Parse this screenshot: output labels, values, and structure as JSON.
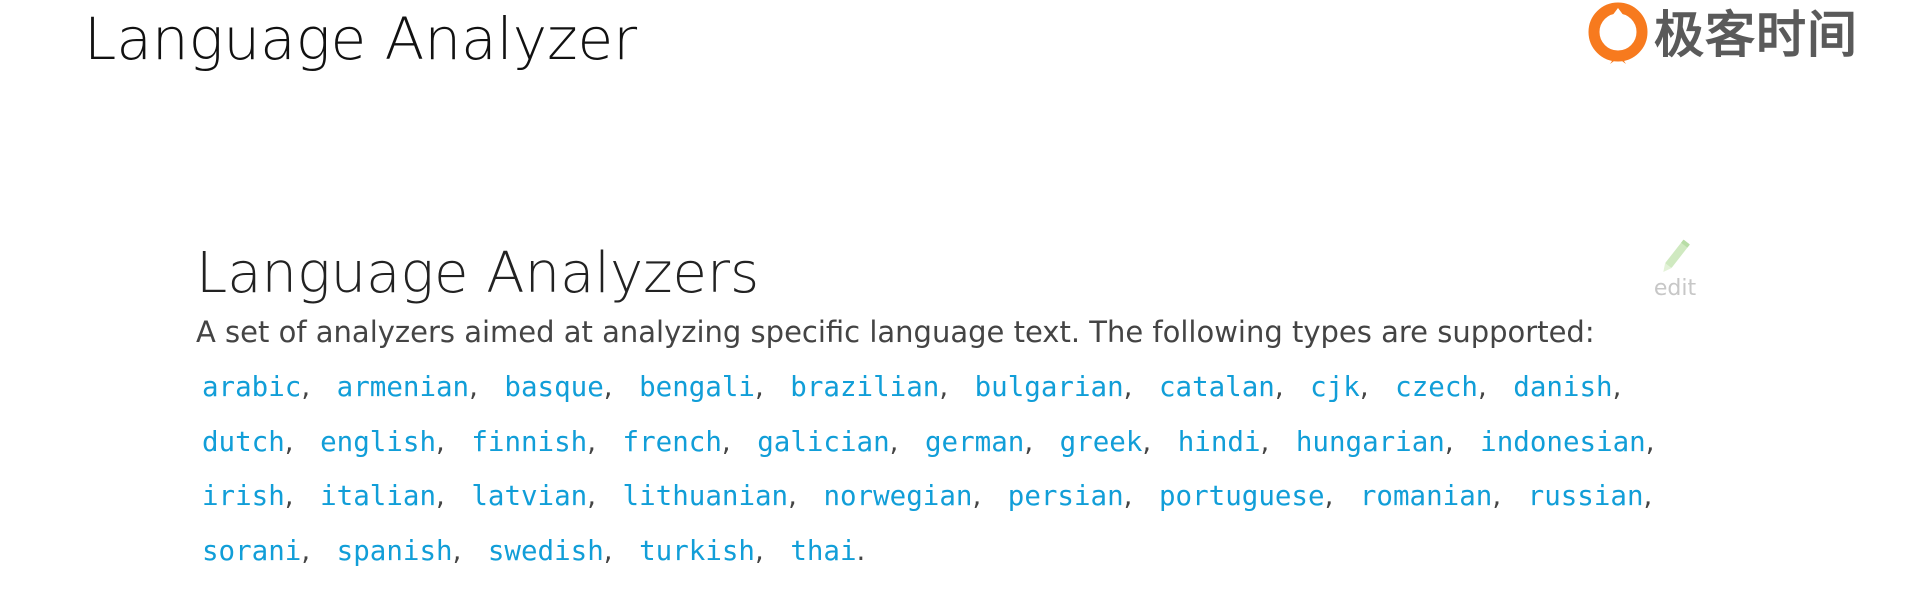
{
  "slide": {
    "title": "Language Analyzer"
  },
  "brand": {
    "name": "极客时间",
    "logo_icon": "geektime-logo-icon",
    "accent_color": "#f77a1e"
  },
  "doc": {
    "title": "Language Analyzers",
    "edit_label": "edit",
    "edit_icon": "pencil-icon",
    "description": "A set of analyzers aimed at analyzing specific language text. The following types are supported:",
    "link_color": "#119ed8",
    "languages": [
      "arabic",
      "armenian",
      "basque",
      "bengali",
      "brazilian",
      "bulgarian",
      "catalan",
      "cjk",
      "czech",
      "danish",
      "dutch",
      "english",
      "finnish",
      "french",
      "galician",
      "german",
      "greek",
      "hindi",
      "hungarian",
      "indonesian",
      "irish",
      "italian",
      "latvian",
      "lithuanian",
      "norwegian",
      "persian",
      "portuguese",
      "romanian",
      "russian",
      "sorani",
      "spanish",
      "swedish",
      "turkish",
      "thai"
    ]
  }
}
